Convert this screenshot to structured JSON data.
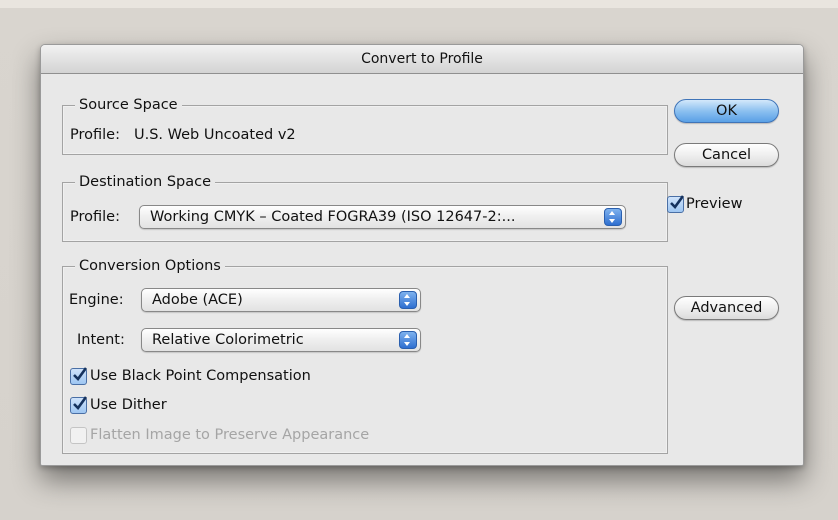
{
  "dialog": {
    "title": "Convert to Profile"
  },
  "source_space": {
    "legend": "Source Space",
    "profile_label": "Profile:",
    "profile_value": "U.S. Web Uncoated v2"
  },
  "destination_space": {
    "legend": "Destination Space",
    "profile_label": "Profile:",
    "profile_value": "Working CMYK – Coated FOGRA39 (ISO 12647-2:..."
  },
  "conversion_options": {
    "legend": "Conversion Options",
    "engine_label": "Engine:",
    "engine_value": "Adobe (ACE)",
    "intent_label": "Intent:",
    "intent_value": "Relative Colorimetric",
    "black_point": {
      "label": "Use Black Point Compensation",
      "checked": true
    },
    "dither": {
      "label": "Use Dither",
      "checked": true
    },
    "flatten": {
      "label": "Flatten Image to Preserve Appearance",
      "checked": false,
      "enabled": false
    }
  },
  "buttons": {
    "ok": "OK",
    "cancel": "Cancel",
    "advanced": "Advanced"
  },
  "preview": {
    "label": "Preview",
    "checked": true
  }
}
